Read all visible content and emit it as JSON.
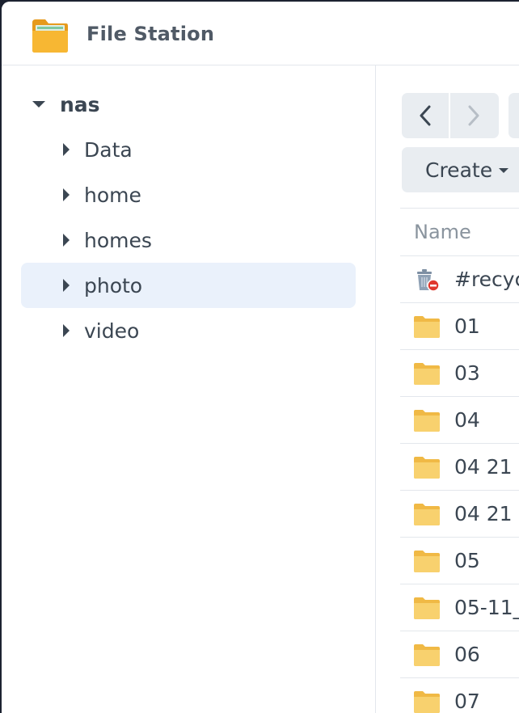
{
  "window": {
    "title": "File Station"
  },
  "sidebar": {
    "root": {
      "label": "nas",
      "icon": "caret-down-icon"
    },
    "items": [
      {
        "label": "Data",
        "icon": "caret-right-icon",
        "selected": false
      },
      {
        "label": "home",
        "icon": "caret-right-icon",
        "selected": false
      },
      {
        "label": "homes",
        "icon": "caret-right-icon",
        "selected": false
      },
      {
        "label": "photo",
        "icon": "caret-right-icon",
        "selected": true
      },
      {
        "label": "video",
        "icon": "caret-right-icon",
        "selected": false
      }
    ]
  },
  "toolbar": {
    "back_icon": "chevron-left-icon",
    "forward_icon": "chevron-right-icon",
    "create_label": "Create"
  },
  "file_list": {
    "columns": [
      "Name"
    ],
    "rows": [
      {
        "name": "#recyc",
        "icon": "recycle-bin-icon"
      },
      {
        "name": "01",
        "icon": "folder-icon"
      },
      {
        "name": "03",
        "icon": "folder-icon"
      },
      {
        "name": "04",
        "icon": "folder-icon"
      },
      {
        "name": "04 21",
        "icon": "folder-icon"
      },
      {
        "name": "04 21",
        "icon": "folder-icon"
      },
      {
        "name": "05",
        "icon": "folder-icon"
      },
      {
        "name": "05-11_",
        "icon": "folder-icon"
      },
      {
        "name": "06",
        "icon": "folder-icon"
      },
      {
        "name": "07",
        "icon": "folder-icon"
      }
    ]
  },
  "colors": {
    "selection": "#eaf1fb",
    "folder": "#f6c95c",
    "button": "#e9edf1",
    "text": "#3b4652"
  }
}
